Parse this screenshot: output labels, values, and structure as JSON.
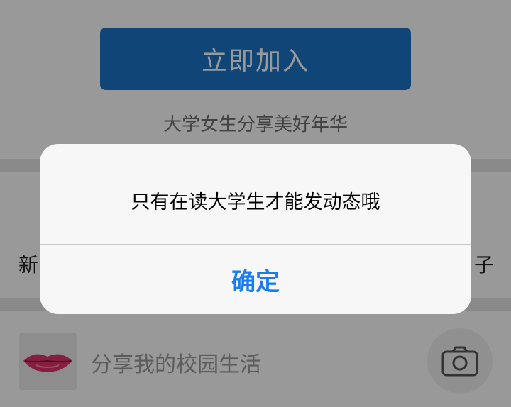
{
  "header": {
    "join_button_label": "立即加入",
    "tagline": "大学女生分享美好年华"
  },
  "tabs": {
    "left_partial": "新",
    "right_partial": "子"
  },
  "composer": {
    "placeholder": "分享我的校园生活",
    "avatar_icon": "lips-icon",
    "camera_icon": "camera-icon"
  },
  "alert": {
    "message": "只有在读大学生才能发动态哦",
    "confirm_label": "确定"
  },
  "colors": {
    "primary_button": "#1976c6",
    "dialog_action": "#1a7cf0",
    "overlay": "rgba(0,0,0,0.4)"
  }
}
